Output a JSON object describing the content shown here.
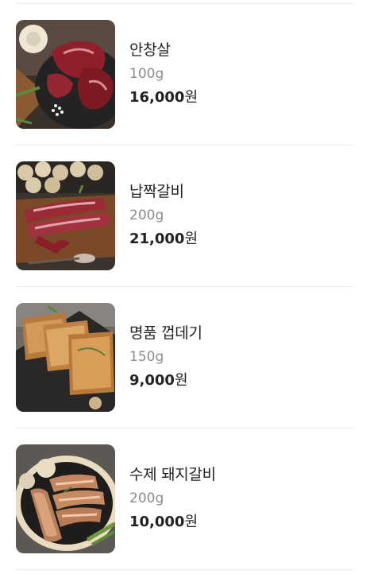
{
  "menu": {
    "items": [
      {
        "name": "안창살",
        "weight": "100g",
        "price": "16,000",
        "currency": "원",
        "image_icon": "beef-skirt-icon"
      },
      {
        "name": "납짝갈비",
        "weight": "200g",
        "price": "21,000",
        "currency": "원",
        "image_icon": "flat-short-rib-icon"
      },
      {
        "name": "명품 껍데기",
        "weight": "150g",
        "price": "9,000",
        "currency": "원",
        "image_icon": "pork-skin-icon"
      },
      {
        "name": "수제 돼지갈비",
        "weight": "200g",
        "price": "10,000",
        "currency": "원",
        "image_icon": "pork-rib-icon"
      }
    ]
  },
  "colors": {
    "text_primary": "#222222",
    "text_secondary": "#8c8c8c",
    "divider": "#ececec"
  }
}
